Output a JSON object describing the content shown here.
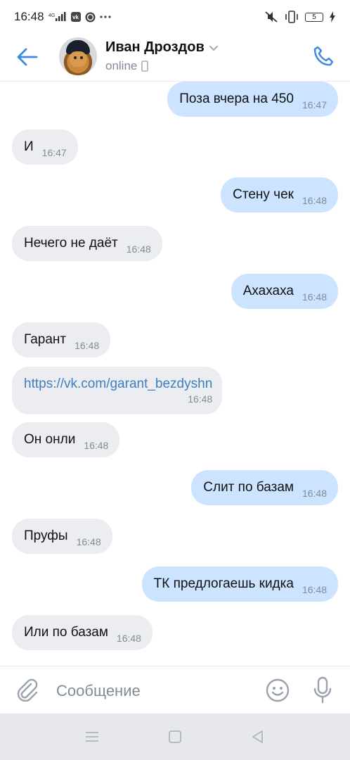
{
  "status_bar": {
    "time": "16:48",
    "network": "4G",
    "battery": "5",
    "icons": [
      "signal-icon",
      "vk-icon",
      "whatsapp-icon",
      "more-icon",
      "mute-icon",
      "vibrate-icon",
      "battery-icon",
      "charging-icon"
    ]
  },
  "header": {
    "contact_name": "Иван Дроздов",
    "status": "online",
    "accent_color": "#3f8ae0"
  },
  "messages": [
    {
      "dir": "out",
      "text": "Поза вчера на 450",
      "time": "16:47"
    },
    {
      "dir": "in",
      "text": "И",
      "time": "16:47"
    },
    {
      "dir": "out",
      "text": "Стену чек",
      "time": "16:48"
    },
    {
      "dir": "in",
      "text": "Нечего не даёт",
      "time": "16:48"
    },
    {
      "dir": "out",
      "text": "Ахахаха",
      "time": "16:48"
    },
    {
      "dir": "in",
      "text": "Гарант",
      "time": "16:48"
    },
    {
      "dir": "in",
      "text": "https://vk.com/garant_bezdyshn",
      "time": "16:48",
      "link": true
    },
    {
      "dir": "in",
      "text": "Он онли",
      "time": "16:48"
    },
    {
      "dir": "out",
      "text": "Слит по базам",
      "time": "16:48"
    },
    {
      "dir": "in",
      "text": "Пруфы",
      "time": "16:48"
    },
    {
      "dir": "out",
      "text": "ТК предлогаешь кидка",
      "time": "16:48"
    },
    {
      "dir": "in",
      "text": "Или по базам",
      "time": "16:48"
    }
  ],
  "composer": {
    "placeholder": "Сообщение"
  },
  "colors": {
    "incoming_bubble": "#ebedf0",
    "outgoing_bubble": "#cce4ff",
    "time_text": "#818c99",
    "link": "#3f7ec0"
  }
}
